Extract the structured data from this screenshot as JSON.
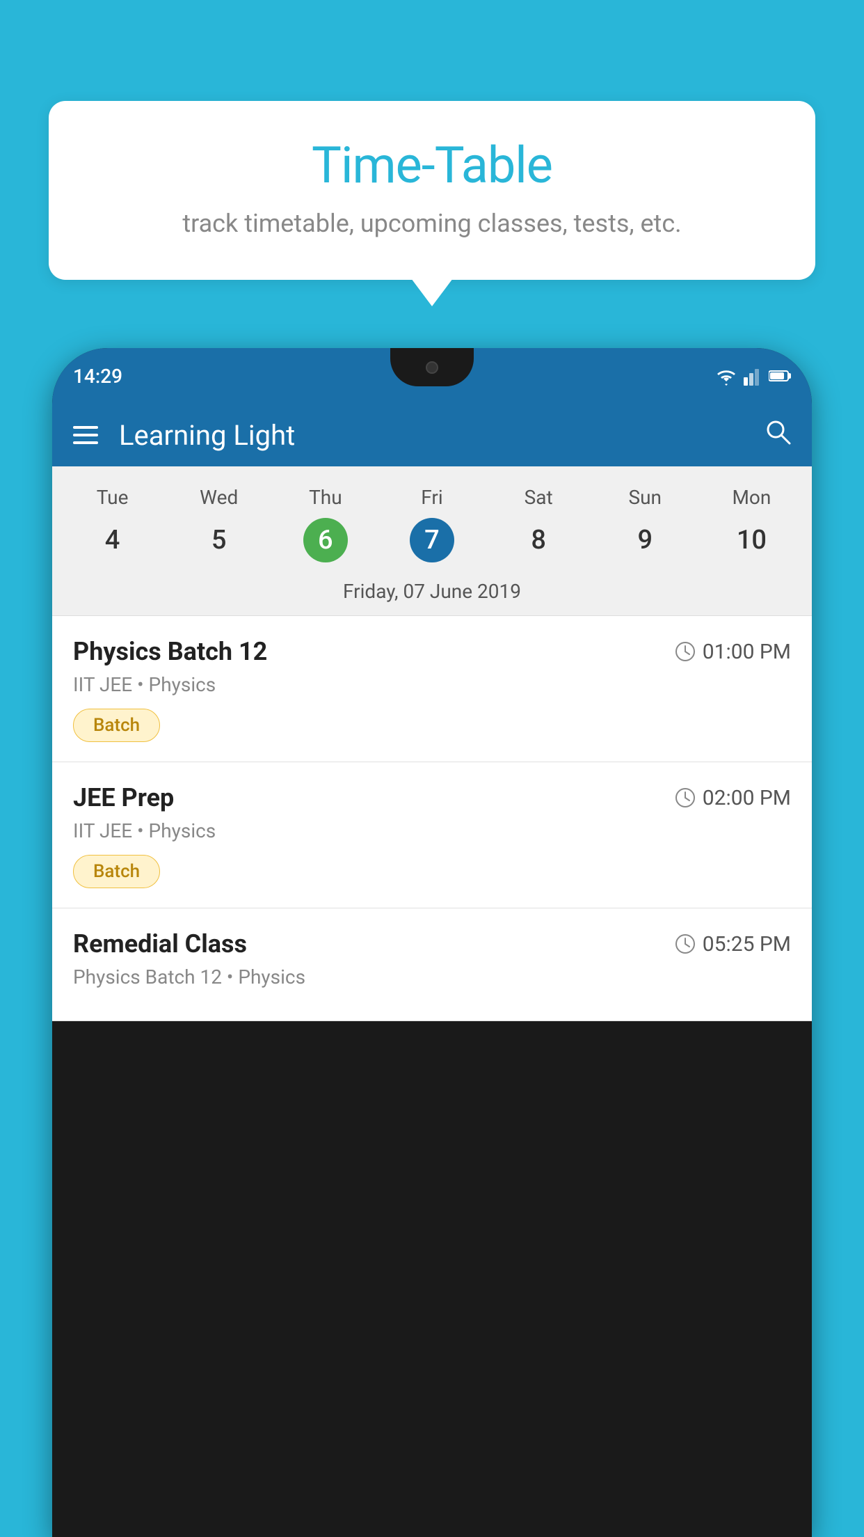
{
  "background_color": "#29B6D8",
  "tooltip": {
    "title": "Time-Table",
    "subtitle": "track timetable, upcoming classes, tests, etc."
  },
  "phone": {
    "status_time": "14:29",
    "header": {
      "app_name": "Learning Light",
      "menu_icon": "hamburger-icon",
      "search_icon": "search-icon"
    },
    "calendar": {
      "days": [
        "Tue",
        "Wed",
        "Thu",
        "Fri",
        "Sat",
        "Sun",
        "Mon"
      ],
      "dates": [
        "4",
        "5",
        "6",
        "7",
        "8",
        "9",
        "10"
      ],
      "today_index": 2,
      "selected_index": 3,
      "selected_date_label": "Friday, 07 June 2019"
    },
    "schedule": [
      {
        "title": "Physics Batch 12",
        "time": "01:00 PM",
        "meta": "IIT JEE • Physics",
        "tag": "Batch"
      },
      {
        "title": "JEE Prep",
        "time": "02:00 PM",
        "meta": "IIT JEE • Physics",
        "tag": "Batch"
      },
      {
        "title": "Remedial Class",
        "time": "05:25 PM",
        "meta": "Physics Batch 12 • Physics",
        "tag": ""
      }
    ]
  }
}
